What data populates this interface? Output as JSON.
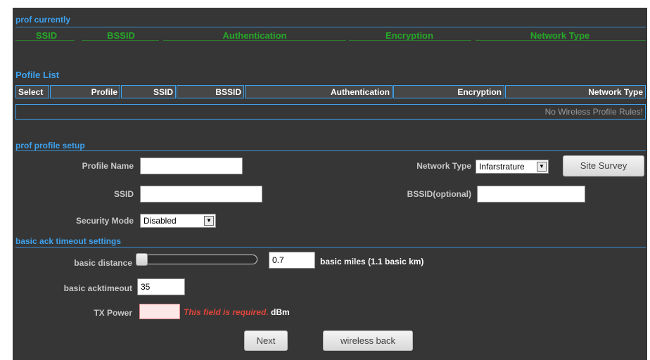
{
  "current": {
    "title": "prof currently",
    "columns": [
      "SSID",
      "BSSID",
      "Authentication",
      "Encryption",
      "Network Type"
    ]
  },
  "profile_list": {
    "title": "Pofile List",
    "columns": [
      "Select",
      "Profile",
      "SSID",
      "BSSID",
      "Authentication",
      "Encryption",
      "Network Type"
    ],
    "empty_message": "No Wireless Profile Rules!"
  },
  "setup": {
    "title": "prof profile setup",
    "profile_name_label": "Profile Name",
    "profile_name_value": "",
    "network_type_label": "Network Type",
    "network_type_value": "Infarstrature",
    "site_survey_label": "Site Survey",
    "ssid_label": "SSID",
    "ssid_value": "",
    "bssid_label": "BSSID(optional)",
    "bssid_value": "",
    "security_mode_label": "Security Mode",
    "security_mode_value": "Disabled"
  },
  "ack": {
    "title": "basic ack timeout settings",
    "distance_label": "basic distance",
    "distance_value": "0.7",
    "distance_level": 0,
    "distance_unit": "basic miles (1.1 basic km)",
    "acktimeout_label": "basic acktimeout",
    "acktimeout_value": "35",
    "txpower_label": "TX Power",
    "txpower_value": "",
    "txpower_error": "This field is required.",
    "txpower_unit": "dBm"
  },
  "buttons": {
    "next": "Next",
    "back": "wireless back"
  },
  "colors": {
    "panel_bg": "#363636",
    "section_title": "#3ea2ee",
    "current_header": "#27a829",
    "error": "#e0453a"
  }
}
